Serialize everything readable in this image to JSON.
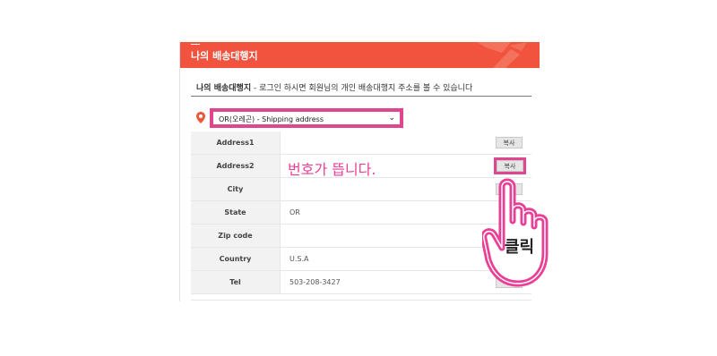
{
  "header": {
    "title": "나의 배송대행지"
  },
  "notice": {
    "strong": "나의 배송대행지",
    "text": " - 로그인 하시면 회원님의 개인 배송대행지 주소를 볼 수 있습니다"
  },
  "select": {
    "value": "OR(오레곤) - Shipping address"
  },
  "rows": [
    {
      "label": "Address1",
      "value": "",
      "copy": "복사"
    },
    {
      "label": "Address2",
      "value": "",
      "copy": "복사"
    },
    {
      "label": "City",
      "value": "",
      "copy": "복사"
    },
    {
      "label": "State",
      "value": "OR",
      "copy": ""
    },
    {
      "label": "Zip code",
      "value": "",
      "copy": ""
    },
    {
      "label": "Country",
      "value": "U.S.A",
      "copy": ""
    },
    {
      "label": "Tel",
      "value": "503-208-3427",
      "copy": "복사"
    }
  ],
  "annotations": {
    "callout": "번호가 뜹니다.",
    "click": "클릭"
  },
  "colors": {
    "header": "#f2533e",
    "highlight": "#e0468f",
    "callout": "#ea3f94"
  }
}
